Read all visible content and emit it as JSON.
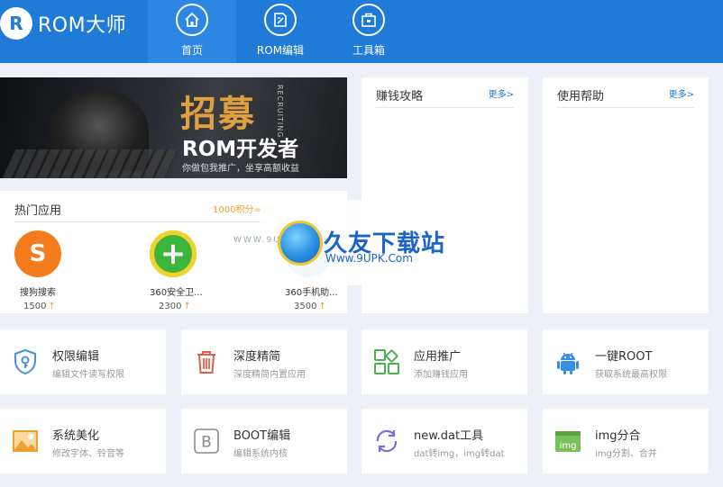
{
  "app": {
    "logo_letter": "R",
    "logo_text": "ROM大师"
  },
  "nav": [
    {
      "label": "首页",
      "icon": "home-icon"
    },
    {
      "label": "ROM编辑",
      "icon": "rom-edit-icon"
    },
    {
      "label": "工具箱",
      "icon": "toolbox-icon"
    }
  ],
  "banner": {
    "title": "招募",
    "subtitle": "ROM开发者",
    "tagline": "你做包我推广，坐享高额收益",
    "vertical": "RECRUITING"
  },
  "hot": {
    "title": "热门应用",
    "note": "1000积分=1元",
    "apps": [
      {
        "name": "搜狗搜索",
        "score": "1500",
        "arrow": "↑",
        "icon": "sogou-icon",
        "color": "#f57c1c",
        "glyph": "S"
      },
      {
        "name": "360安全卫...",
        "score": "2300",
        "arrow": "↑",
        "icon": "360-security-icon",
        "color": "#3bb53b",
        "glyph": "+"
      },
      {
        "name": "360手机助...",
        "score": "3500",
        "arrow": "↑",
        "icon": "360-assistant-icon",
        "color": "#2d8fe0",
        "glyph": ""
      }
    ]
  },
  "earn": {
    "title": "赚钱攻略",
    "more": "更多>"
  },
  "help": {
    "title": "使用帮助",
    "more": "更多>"
  },
  "tools": [
    {
      "name": "权限编辑",
      "desc": "编辑文件读写权限",
      "icon": "shield-key-icon",
      "color": "#4a90d9"
    },
    {
      "name": "深度精简",
      "desc": "深度精简内置应用",
      "icon": "trash-icon",
      "color": "#e0604a"
    },
    {
      "name": "应用推广",
      "desc": "添加赚钱应用",
      "icon": "apps-grid-icon",
      "color": "#4caf50"
    },
    {
      "name": "一键ROOT",
      "desc": "获取系统最高权限",
      "icon": "android-icon",
      "color": "#3a8ee6"
    },
    {
      "name": "系统美化",
      "desc": "修改字体、铃音等",
      "icon": "image-icon",
      "color": "#f0a030"
    },
    {
      "name": "BOOT编辑",
      "desc": "编辑系统内核",
      "icon": "boot-b-icon",
      "color": "#888888"
    },
    {
      "name": "new.dat工具",
      "desc": "dat转img，img转dat",
      "icon": "convert-icon",
      "color": "#7a6fd8"
    },
    {
      "name": "img分合",
      "desc": "img分割、合并",
      "icon": "img-split-icon",
      "color": "#6ab04c"
    }
  ],
  "watermark": {
    "brand": "久友下载站",
    "url": "Www.9UPK.Com",
    "left": "WWW.9UPK.COM"
  }
}
